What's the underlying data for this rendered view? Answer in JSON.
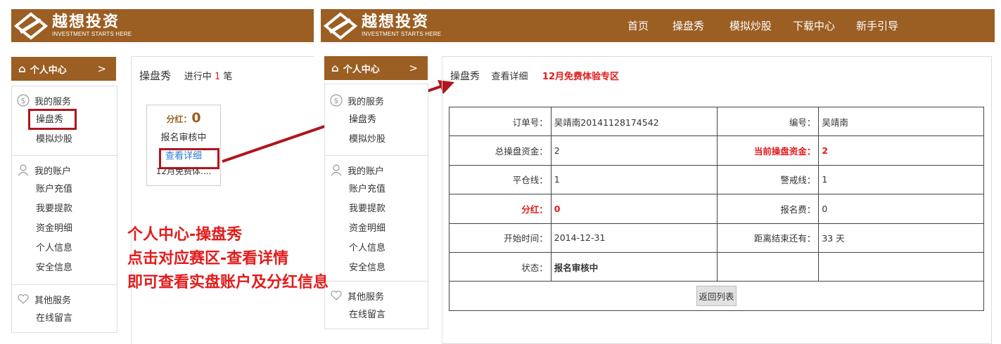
{
  "brand": {
    "name_cn": "越想投资",
    "slogan": "INVESTMENT STARTS HERE"
  },
  "nav": [
    "首页",
    "操盘秀",
    "模拟炒股",
    "下载中心",
    "新手引导"
  ],
  "sidebar": {
    "header": "个人中心",
    "header_chevron": ">",
    "groups": [
      {
        "title": "我的服务",
        "icon": "dollar-icon",
        "items": [
          "操盘秀",
          "模拟炒股"
        ]
      },
      {
        "title": "我的账户",
        "icon": "user-icon",
        "items": [
          "账户充值",
          "我要提款",
          "资金明细",
          "个人信息",
          "安全信息"
        ]
      },
      {
        "title": "其他服务",
        "icon": "heart-icon",
        "items": [
          "在线留言"
        ]
      }
    ]
  },
  "left_panel": {
    "title": "操盘秀",
    "status_prefix": "进行中",
    "status_count": "1",
    "status_suffix": "笔",
    "card": {
      "dividend_label": "分红：",
      "dividend_value": "0",
      "status": "报名审核中",
      "detail_link": "查看详细",
      "event_name": "12月免费体...."
    }
  },
  "annotation": {
    "line1": "个人中心-操盘秀",
    "line2": "点击对应赛区-查看详情",
    "line3": "即可查看实盘账户及分红信息"
  },
  "right_panel": {
    "breadcrumb": {
      "section": "操盘秀",
      "page": "查看详细",
      "event": "12月免费体验专区"
    },
    "rows": [
      {
        "l1": "订单号：",
        "v1": "吴靖南20141128174542",
        "l2": "编号：",
        "v2": "吴靖南"
      },
      {
        "l1": "总操盘资金：",
        "v1": "2",
        "l2": "当前操盘资金：",
        "v2": "2"
      },
      {
        "l1": "平仓线：",
        "v1": "1",
        "l2": "警戒线：",
        "v2": "1"
      },
      {
        "l1": "分红：",
        "v1": "0",
        "l2": "报名费：",
        "v2": "0"
      },
      {
        "l1": "开始时间：",
        "v1": "2014-12-31",
        "l2": "距离结束还有：",
        "v2": "33 天"
      },
      {
        "l1": "状态：",
        "v1": "报名审核中",
        "l2": "",
        "v2": ""
      }
    ],
    "back_button": "返回列表"
  },
  "colors": {
    "brand_brown": "#9b5e23",
    "accent_red": "#e31b1b",
    "highlight_box": "#b0151c",
    "link_blue": "#2a7ad2"
  }
}
